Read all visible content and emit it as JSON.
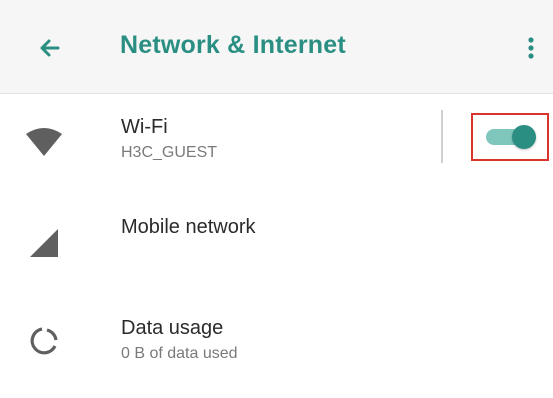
{
  "app_bar": {
    "title": "Network & Internet",
    "back_icon": "arrow-back-icon",
    "menu_icon": "more-vert-icon"
  },
  "items": [
    {
      "label": "Wi-Fi",
      "summary": "H3C_GUEST",
      "icon": "wifi-icon",
      "toggle_on": true
    },
    {
      "label": "Mobile network",
      "icon": "cellular-signal-icon"
    },
    {
      "label": "Data usage",
      "summary": "0 B of data used",
      "icon": "data-usage-icon"
    }
  ],
  "colors": {
    "accent": "#2a8f82",
    "accent_light": "#7fc6bd",
    "highlight": "#d9342b",
    "icon_gray": "#5f5f5f"
  }
}
